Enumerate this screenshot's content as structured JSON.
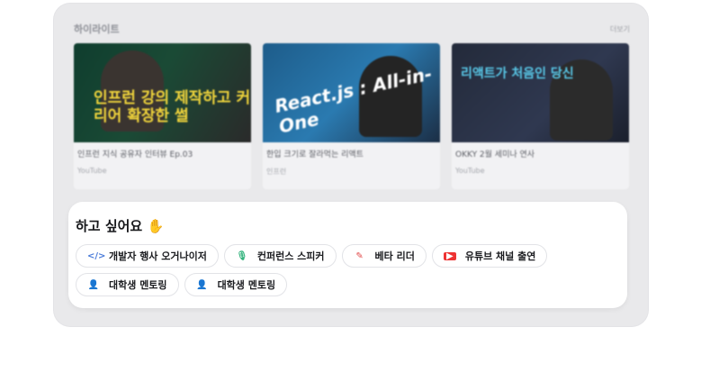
{
  "highlight": {
    "title": "하이라이트",
    "more_label": "더보기",
    "cards": [
      {
        "thumb_text": "인프런 강의 제작하고 커리어 확장한 썰",
        "name": "인프런 지식 공유자 인터뷰 Ep.03",
        "source": "YouTube"
      },
      {
        "thumb_text": "React.js : All-in-One",
        "name": "한입 크기로 잘라먹는 리액트",
        "source": "인프런"
      },
      {
        "thumb_text": "리액트가 처음인 당신",
        "name": "OKKY 2월 세미나 연사",
        "source": "YouTube"
      }
    ]
  },
  "want": {
    "title": "하고 싶어요 ✋",
    "chips": [
      {
        "icon": "code-icon",
        "glyph": "</>",
        "label": "개발자 행사 오거나이저"
      },
      {
        "icon": "mic-icon",
        "glyph": "🎙",
        "label": "컨퍼런스 스피커"
      },
      {
        "icon": "pen-icon",
        "glyph": "✎",
        "label": "베타 리더"
      },
      {
        "icon": "youtube-icon",
        "glyph": "▶",
        "label": "유튜브 채널 출연"
      },
      {
        "icon": "mentoring-icon",
        "glyph": "👤",
        "label": "대학생 멘토링"
      },
      {
        "icon": "mentoring-icon",
        "glyph": "👤",
        "label": "대학생 멘토링"
      }
    ]
  }
}
